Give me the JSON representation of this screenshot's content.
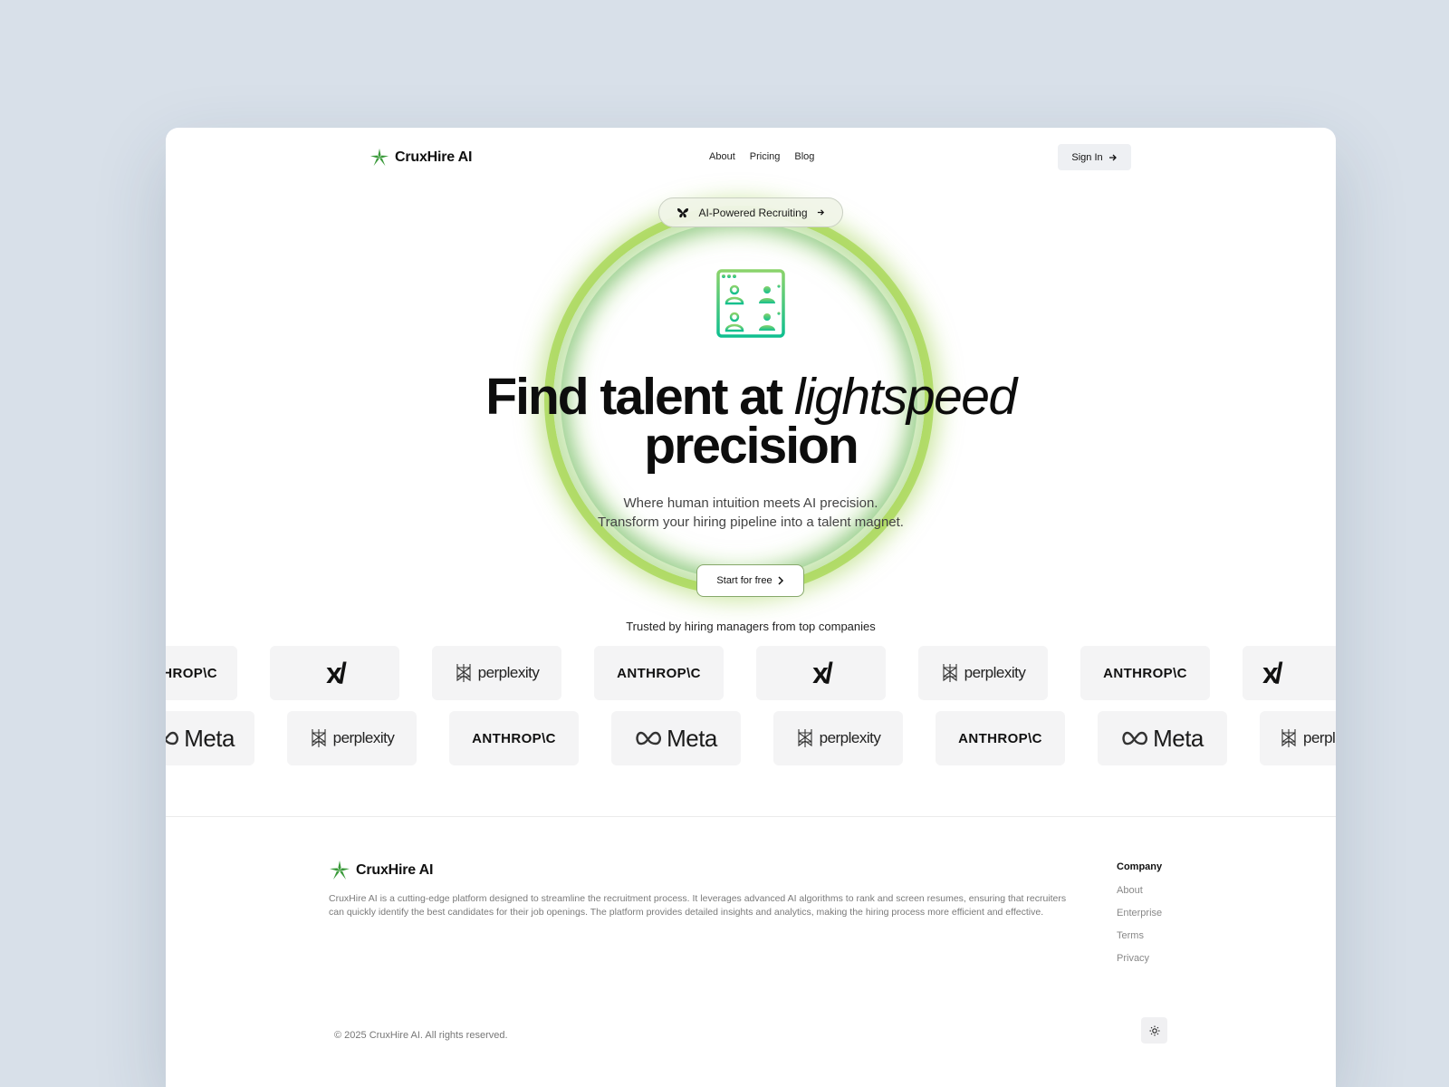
{
  "brand": {
    "name": "CruxHire AI",
    "accent": "#3a9a3a"
  },
  "nav": {
    "links": [
      "About",
      "Pricing",
      "Blog"
    ],
    "signin_label": "Sign In"
  },
  "hero": {
    "badge_label": "AI-Powered Recruiting",
    "headline_main": "Find talent at",
    "headline_italic": "lightspeed",
    "headline_line2": "precision",
    "sub_line1": "Where human intuition meets AI precision.",
    "sub_line2": "Transform your hiring pipeline into a talent magnet.",
    "cta_label": "Start for free",
    "ring_color": "#a8d85a",
    "icon_gradient": [
      "#8ad36b",
      "#0fbf8f"
    ]
  },
  "trusted": {
    "label": "Trusted by hiring managers from top companies",
    "row1": [
      "ANTHROP\\C",
      "xAI",
      "perplexity",
      "ANTHROP\\C",
      "xAI",
      "perplexity",
      "ANTHROP\\C",
      "xAI"
    ],
    "row2": [
      "Meta",
      "perplexity",
      "ANTHROP\\C",
      "Meta",
      "perplexity",
      "ANTHROP\\C",
      "Meta",
      "perplexity"
    ]
  },
  "footer": {
    "brand_name": "CruxHire AI",
    "description": "CruxHire AI is a cutting-edge platform designed to streamline the recruitment process. It leverages advanced AI algorithms to rank and screen resumes, ensuring that recruiters can quickly identify the best candidates for their job openings. The platform provides detailed insights and analytics, making the hiring process more efficient and effective.",
    "company_title": "Company",
    "company_links": [
      "About",
      "Enterprise",
      "Terms",
      "Privacy"
    ],
    "copyright": "© 2025 CruxHire AI. All rights reserved."
  }
}
